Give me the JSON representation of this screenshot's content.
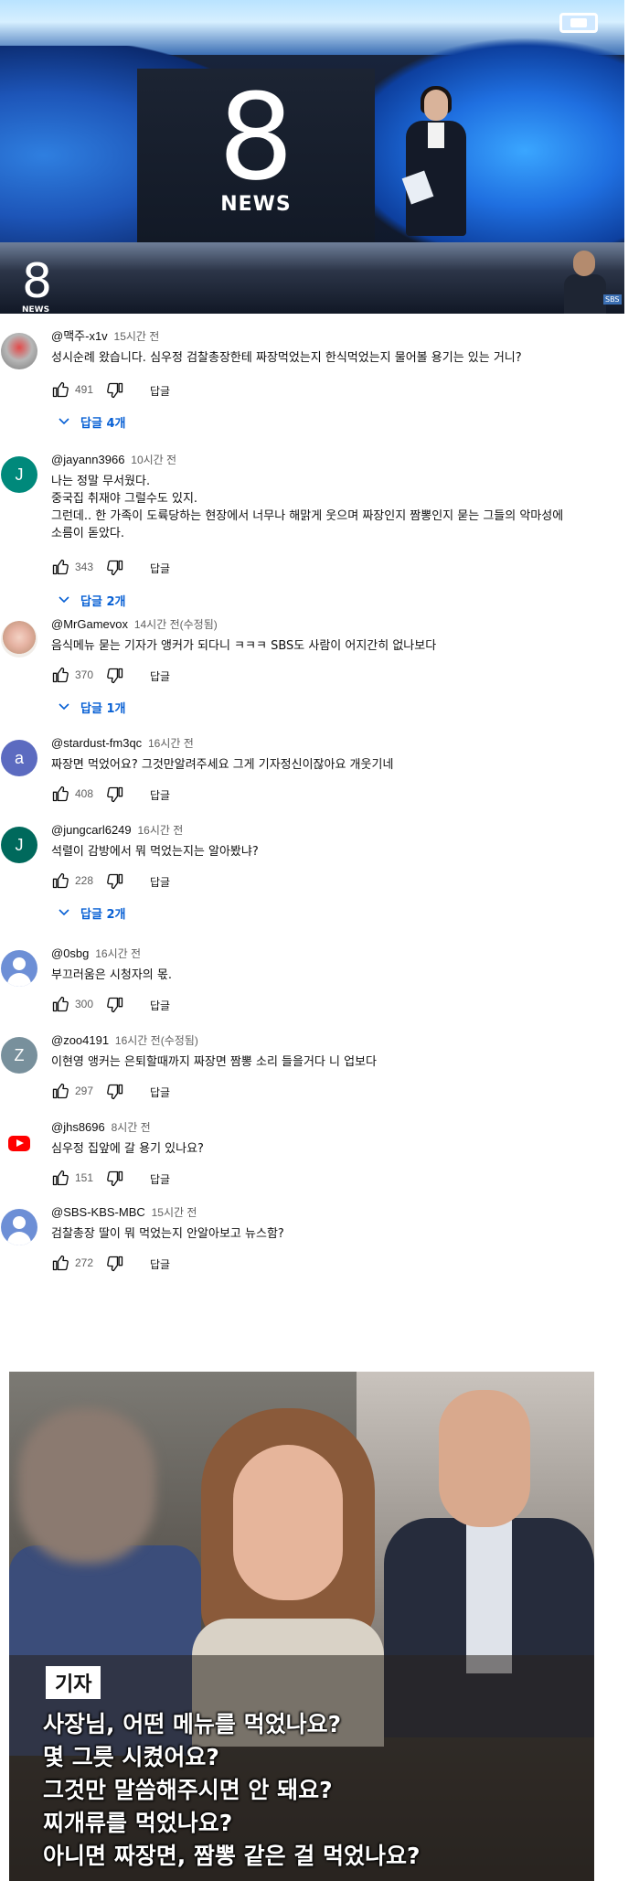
{
  "news_logo": {
    "word": "NEWS",
    "digit": "8",
    "badge": "SBS"
  },
  "comments": [
    {
      "author": "@맥주-x1v",
      "time": "15시간 전",
      "text": "성시순례 왔습니다. 심우정 검찰총장한테 짜장먹었는지 한식먹었는지 물어볼 용기는 있는 거니?",
      "likes": "491",
      "reply_label": "답글",
      "replies": "답글 4개",
      "avatar": "photo"
    },
    {
      "author": "@jayann3966",
      "time": "10시간 전",
      "text": "나는 정말 무서웠다.\n중국집 취재야 그럴수도 있지.\n그런데.. 한 가족이 도륙당하는 현장에서 너무나 해맑게 웃으며 짜장인지 짬뽕인지 묻는 그들의 악마성에\n소름이 돋았다.",
      "likes": "343",
      "reply_label": "답글",
      "replies": "답글 2개",
      "avatar_letter": "J",
      "avatar_color": "#00897b"
    },
    {
      "author": "@MrGamevox",
      "time": "14시간 전(수정됨)",
      "text": "음식메뉴 묻는 기자가 앵커가 되다니 ㅋㅋㅋ SBS도 사람이 어지간히 없나보다",
      "likes": "370",
      "reply_label": "답글",
      "replies": "답글 1개",
      "avatar": "photo"
    },
    {
      "author": "@stardust-fm3qc",
      "time": "16시간 전",
      "text": "짜장면 먹었어요?  그것만알려주세요 그게 기자정신이잖아요 개웃기네",
      "likes": "408",
      "reply_label": "답글",
      "avatar_letter": "a",
      "avatar_color": "#5c6bc0"
    },
    {
      "author": "@jungcarl6249",
      "time": "16시간 전",
      "text": "석렬이 감방에서 뭐 먹었는지는 알아봤냐?",
      "likes": "228",
      "reply_label": "답글",
      "replies": "답글 2개",
      "avatar_letter": "J",
      "avatar_color": "#00695c"
    },
    {
      "author": "@0sbg",
      "time": "16시간 전",
      "text": "부끄러움은 시청자의 몫.",
      "likes": "300",
      "reply_label": "답글",
      "avatar": "default"
    },
    {
      "author": "@zoo4191",
      "time": "16시간 전(수정됨)",
      "text": "이현영 앵커는 은퇴할때까지 짜장면 짬뽕 소리 들을거다 니 업보다",
      "likes": "297",
      "reply_label": "답글",
      "avatar_letter": "Z",
      "avatar_color": "#78909c"
    },
    {
      "author": "@jhs8696",
      "time": "8시간 전",
      "text": "심우정 집앞에 갈 용기 있나요?",
      "likes": "151",
      "reply_label": "답글",
      "avatar": "youtube"
    },
    {
      "author": "@SBS-KBS-MBC",
      "time": "15시간 전",
      "text": "검찰총장 딸이 뭐 먹었는지 안알아보고 뉴스함?",
      "likes": "272",
      "reply_label": "답글",
      "avatar": "default"
    }
  ],
  "capture": {
    "tag": "기자",
    "lines": [
      "사장님, 어떤 메뉴를 먹었나요?",
      "몇 그릇 시켰어요?",
      "그것만 말씀해주시면 안 돼요?",
      "찌개류를 먹었나요?",
      "아니면 짜장면, 짬뽕 같은 걸 먹었나요?"
    ]
  }
}
